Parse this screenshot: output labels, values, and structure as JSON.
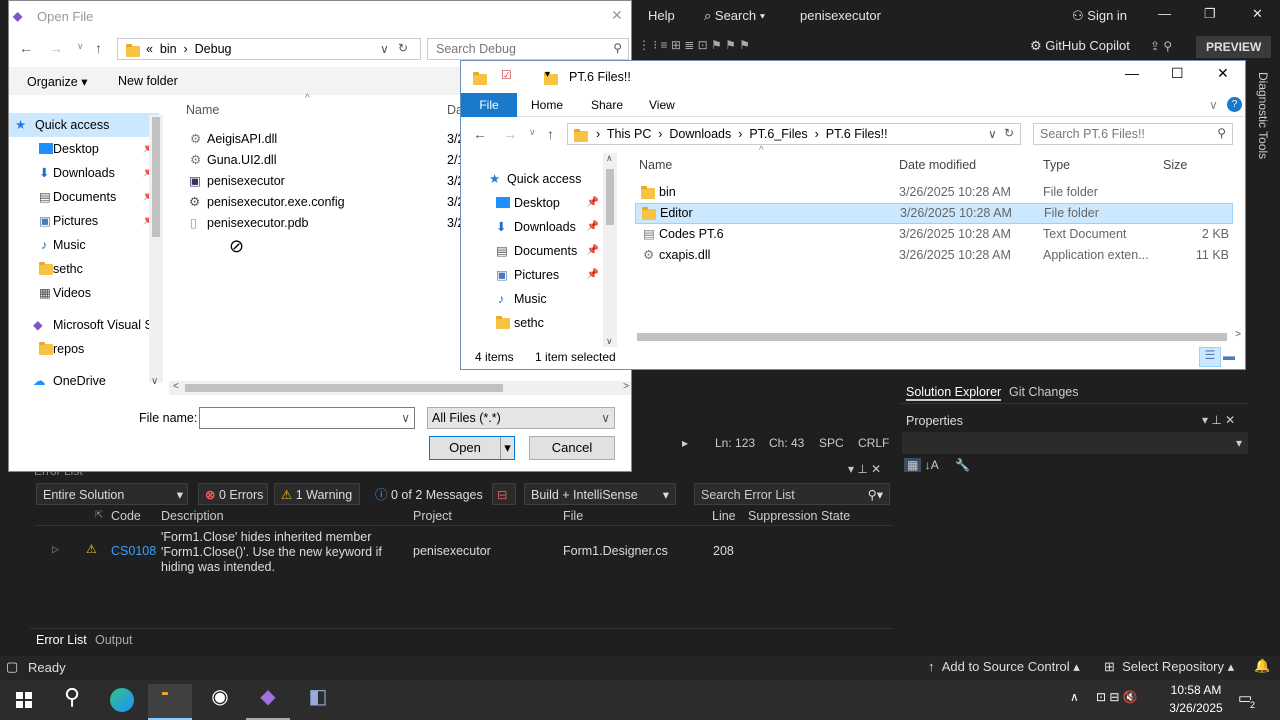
{
  "vs": {
    "menu_help": "Help",
    "search": "Search",
    "solution_name": "penisexecutor",
    "sign_in": "Sign in",
    "copilot": "GitHub Copilot",
    "preview": "PREVIEW",
    "diagnostic_tools": "Diagnostic Tools",
    "editor_status": {
      "ln": "Ln: 123",
      "ch": "Ch: 43",
      "spc": "SPC",
      "crlf": "CRLF"
    },
    "solution_explorer_tab": "Solution Explorer",
    "git_changes_tab": "Git Changes",
    "properties_title": "Properties",
    "status_ready": "Ready",
    "add_to_source_control": "Add to Source Control",
    "select_repository": "Select Repository"
  },
  "error_list": {
    "title": "Error List",
    "scope": "Entire Solution",
    "errors": "0 Errors",
    "warnings": "1 Warning",
    "messages": "0 of 2 Messages",
    "build_filter": "Build + IntelliSense",
    "search_placeholder": "Search Error List",
    "columns": {
      "code": "Code",
      "description": "Description",
      "project": "Project",
      "file": "File",
      "line": "Line",
      "suppression": "Suppression State"
    },
    "rows": [
      {
        "code": "CS0108",
        "description": "'Form1.Close' hides inherited member 'Form1.Close()'. Use the new keyword if hiding was intended.",
        "project": "penisexecutor",
        "file": "Form1.Designer.cs",
        "line": "208"
      }
    ],
    "tab_error_list": "Error List",
    "tab_output": "Output"
  },
  "open_file": {
    "title": "Open File",
    "breadcrumb": [
      "«",
      "bin",
      "Debug"
    ],
    "search_placeholder": "Search Debug",
    "organize": "Organize",
    "new_folder": "New folder",
    "nav": [
      {
        "label": "Quick access",
        "pin": false
      },
      {
        "label": "Desktop",
        "pin": true
      },
      {
        "label": "Downloads",
        "pin": true
      },
      {
        "label": "Documents",
        "pin": true
      },
      {
        "label": "Pictures",
        "pin": true
      },
      {
        "label": "Music",
        "pin": false
      },
      {
        "label": "sethc",
        "pin": false
      },
      {
        "label": "Videos",
        "pin": false
      },
      {
        "label": "Microsoft Visual S",
        "pin": false
      },
      {
        "label": "repos",
        "pin": false
      },
      {
        "label": "OneDrive",
        "pin": false
      }
    ],
    "column_name": "Name",
    "column_date_partial": "Da",
    "files": [
      {
        "name": "AeigisAPI.dll",
        "date": "3/2"
      },
      {
        "name": "Guna.UI2.dll",
        "date": "2/1"
      },
      {
        "name": "penisexecutor",
        "date": "3/2"
      },
      {
        "name": "penisexecutor.exe.config",
        "date": "3/2"
      },
      {
        "name": "penisexecutor.pdb",
        "date": "3/2"
      }
    ],
    "file_name_label": "File name:",
    "file_name_value": "",
    "filter": "All Files (*.*)",
    "open_button": "Open",
    "cancel_button": "Cancel"
  },
  "explorer": {
    "title": "PT.6 Files!!",
    "ribbon": {
      "file": "File",
      "home": "Home",
      "share": "Share",
      "view": "View"
    },
    "breadcrumb": [
      "This PC",
      "Downloads",
      "PT.6_Files",
      "PT.6 Files!!"
    ],
    "search_placeholder": "Search PT.6 Files!!",
    "nav": [
      {
        "label": "Quick access",
        "pin": false
      },
      {
        "label": "Desktop",
        "pin": true
      },
      {
        "label": "Downloads",
        "pin": true
      },
      {
        "label": "Documents",
        "pin": true
      },
      {
        "label": "Pictures",
        "pin": true
      },
      {
        "label": "Music",
        "pin": false
      },
      {
        "label": "sethc",
        "pin": false
      }
    ],
    "columns": {
      "name": "Name",
      "date": "Date modified",
      "type": "Type",
      "size": "Size"
    },
    "files": [
      {
        "name": "bin",
        "date": "3/26/2025 10:28 AM",
        "type": "File folder",
        "size": "",
        "selected": false
      },
      {
        "name": "Editor",
        "date": "3/26/2025 10:28 AM",
        "type": "File folder",
        "size": "",
        "selected": true
      },
      {
        "name": "Codes PT.6",
        "date": "3/26/2025 10:28 AM",
        "type": "Text Document",
        "size": "2 KB",
        "selected": false
      },
      {
        "name": "cxapis.dll",
        "date": "3/26/2025 10:28 AM",
        "type": "Application exten...",
        "size": "11 KB",
        "selected": false
      }
    ],
    "item_count": "4 items",
    "selected_count": "1 item selected"
  },
  "taskbar": {
    "time": "10:58 AM",
    "date": "3/26/2025",
    "notification_count": "2"
  }
}
